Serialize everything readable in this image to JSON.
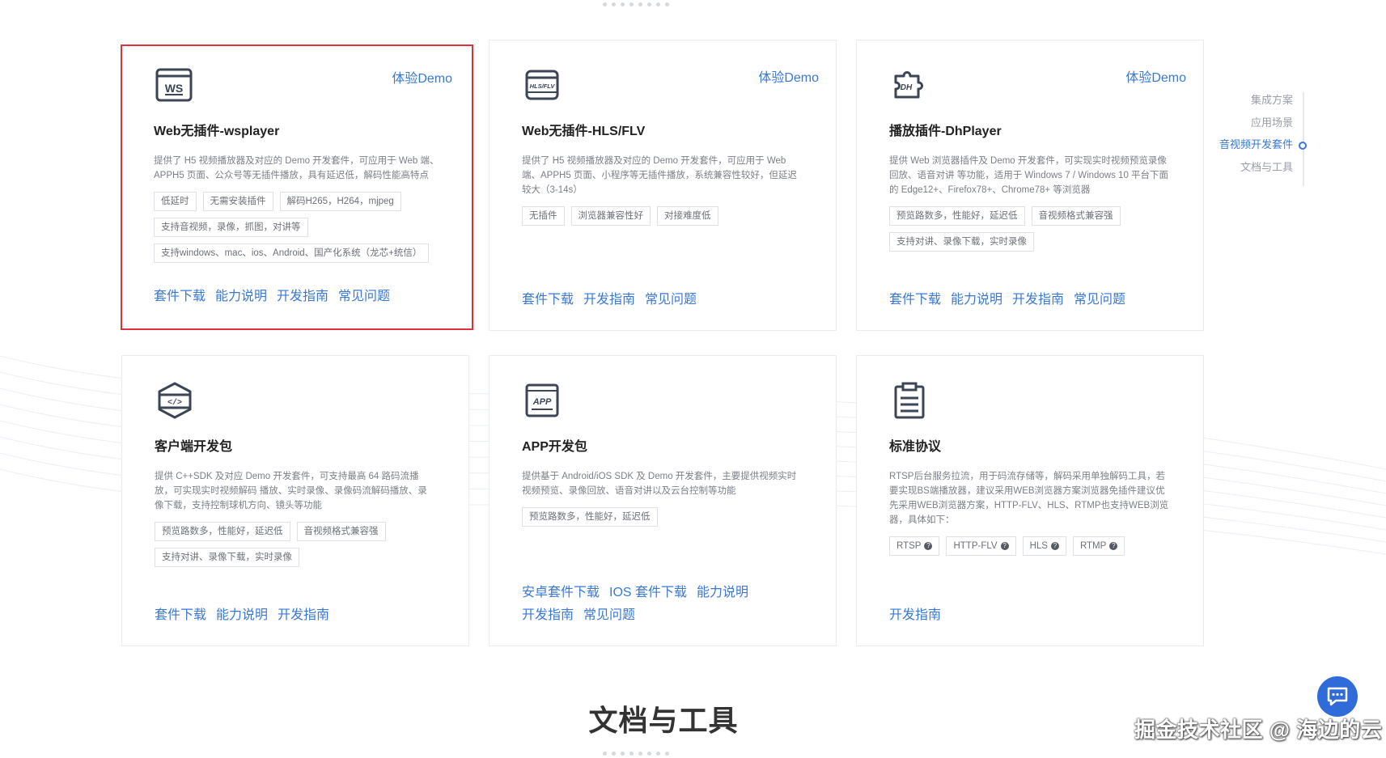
{
  "cards": [
    {
      "icon": "ws-icon",
      "demo": "体验Demo",
      "title": "Web无插件-wsplayer",
      "desc": "提供了 H5 视频播放器及对应的 Demo 开发套件，可应用于 Web 端、APPH5 页面、公众号等无插件播放，具有延迟低，解码性能高特点",
      "tags": [
        "低延时",
        "无需安装插件",
        "解码H265，H264，mjpeg",
        "支持音视频，录像，抓图，对讲等",
        "支持windows、mac、ios、Android、国产化系统（龙芯+统信）"
      ],
      "links": [
        "套件下载",
        "能力说明",
        "开发指南",
        "常见问题"
      ]
    },
    {
      "icon": "hls-flv-icon",
      "demo": "体验Demo",
      "title": "Web无插件-HLS/FLV",
      "desc": "提供了 H5 视频播放器及对应的 Demo 开发套件，可应用于 Web 端、APPH5 页面、小程序等无插件播放，系统兼容性较好，但延迟较大（3-14s）",
      "tags": [
        "无插件",
        "浏览器兼容性好",
        "对接难度低"
      ],
      "links": [
        "套件下载",
        "开发指南",
        "常见问题"
      ]
    },
    {
      "icon": "plugin-dh-icon",
      "demo": "体验Demo",
      "title": "播放插件-DhPlayer",
      "desc": "提供 Web 浏览器插件及 Demo 开发套件，可实现实时视频预览录像回放、语音对讲 等功能，适用于 Windows 7 / Windows 10 平台下面的 Edge12+、Firefox78+、Chrome78+ 等浏览器",
      "tags": [
        "预览路数多，性能好，延迟低",
        "音视频格式兼容强",
        "支持对讲、录像下载，实时录像"
      ],
      "links": [
        "套件下载",
        "能力说明",
        "开发指南",
        "常见问题"
      ]
    },
    {
      "icon": "code-sdk-icon",
      "demo": "",
      "title": "客户端开发包",
      "desc": "提供 C++SDK 及对应 Demo 开发套件，可支持最高 64 路码流播放，可实现实时视频解码 播放、实时录像、录像码流解码播放、录像下载，支持控制球机方向、镜头等功能",
      "tags": [
        "预览路数多，性能好，延迟低",
        "音视频格式兼容强",
        "支持对讲、录像下载，实时录像"
      ],
      "links": [
        "套件下载",
        "能力说明",
        "开发指南"
      ]
    },
    {
      "icon": "app-icon",
      "demo": "",
      "title": "APP开发包",
      "desc": "提供基于 Android/iOS SDK 及 Demo 开发套件，主要提供视频实时视频预览、录像回放、语音对讲以及云台控制等功能",
      "tags": [
        "预览路数多，性能好，延迟低"
      ],
      "links": [
        "安卓套件下载",
        "IOS 套件下载",
        "能力说明",
        "开发指南",
        "常见问题"
      ]
    },
    {
      "icon": "protocol-doc-icon",
      "demo": "",
      "title": "标准协议",
      "desc": "RTSP后台服务拉流，用于码流存储等，解码采用单独解码工具，若要实现BS端播放器，建议采用WEB浏览器方案浏览器免插件建议优先采用WEB浏览器方案，HTTP-FLV、HLS、RTMP也支持WEB浏览器，具体如下：",
      "tags": [
        "RTSP",
        "HTTP-FLV",
        "HLS",
        "RTMP"
      ],
      "links": [
        "开发指南"
      ]
    }
  ],
  "side_nav": [
    "集成方案",
    "应用场景",
    "音视频开发套件",
    "文档与工具"
  ],
  "side_nav_active": 2,
  "section_title": "文档与工具",
  "watermark": "掘金技术社区 @ 海边的云",
  "colors": {
    "accent": "#3a78d6",
    "selected_border": "#e0313a",
    "chat_button": "#2f6bd9"
  }
}
